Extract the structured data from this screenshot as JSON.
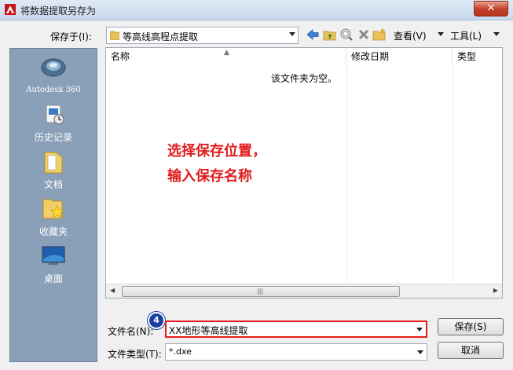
{
  "window": {
    "title": "将数据提取另存为",
    "close_glyph": "✕"
  },
  "location": {
    "label": "保存于(I):",
    "value": "等高线高程点提取"
  },
  "toolbar": {
    "view_label": "查看(V)",
    "tools_label": "工具(L)"
  },
  "places": [
    {
      "label": "Autodesk 360",
      "icon": "autodesk-360-icon"
    },
    {
      "label": "历史记录",
      "icon": "history-icon"
    },
    {
      "label": "文档",
      "icon": "documents-folder-icon"
    },
    {
      "label": "收藏夹",
      "icon": "favorites-folder-icon"
    },
    {
      "label": "桌面",
      "icon": "desktop-icon"
    }
  ],
  "filelist": {
    "columns": [
      "名称",
      "修改日期",
      "类型"
    ],
    "empty_message": "该文件夹为空。"
  },
  "annotation": {
    "line1": "选择保存位置，",
    "line2": "输入保存名称",
    "color": "#e11c1c"
  },
  "step_badge": "4",
  "filename": {
    "label": "文件名(N):",
    "value": "XX地形等高线提取",
    "highlight_color": "#e41b1b"
  },
  "filetype": {
    "label": "文件类型(T):",
    "value": "*.dxe"
  },
  "buttons": {
    "save": "保存(S)",
    "cancel": "取消"
  },
  "scrollbar": {
    "grip": "|||",
    "left_arrow": "◀",
    "right_arrow": "▶"
  }
}
